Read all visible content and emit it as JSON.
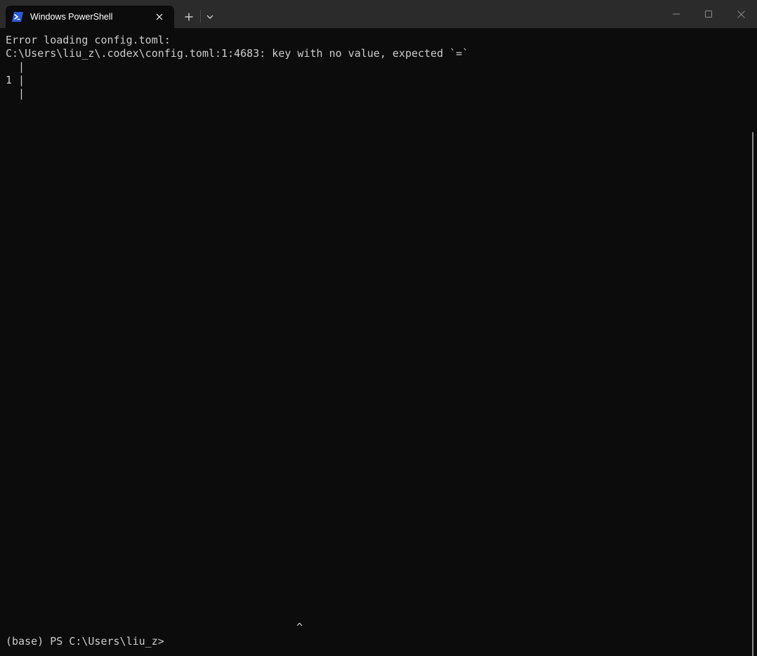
{
  "window": {
    "tab_title": "Windows PowerShell",
    "tab_icon": "powershell-icon",
    "new_tab_icon": "plus-icon",
    "dropdown_icon": "chevron-down-icon",
    "minimize_icon": "minimize-icon",
    "maximize_icon": "maximize-icon",
    "close_icon": "close-icon"
  },
  "terminal": {
    "lines": [
      "Error loading config.toml:",
      "C:\\Users\\liu_z\\.codex\\config.toml:1:4683: key with no value, expected `=`",
      "  |",
      "1 |",
      "  |"
    ],
    "caret_line": "^",
    "prompt": "(base) PS C:\\Users\\liu_z>"
  },
  "colors": {
    "background": "#0c0c0c",
    "titlebar": "#2b2b2b",
    "foreground": "#cccccc",
    "powershell_blue": "#2a5ad7"
  }
}
